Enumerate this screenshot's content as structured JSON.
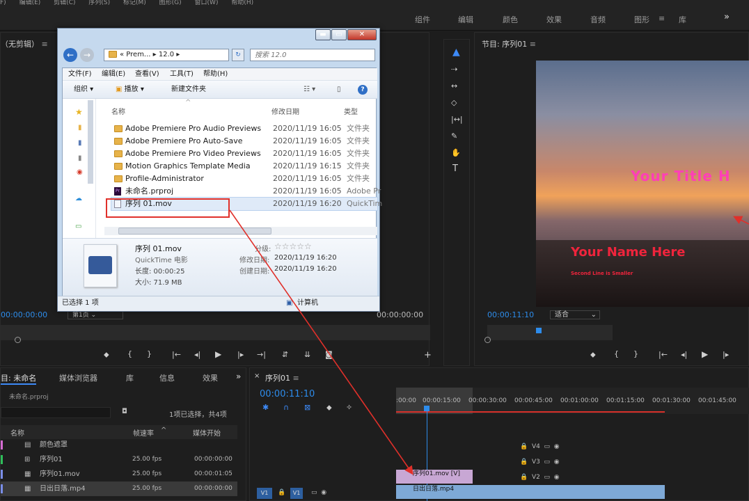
{
  "menubar": [
    "F)",
    "编辑(E)",
    "剪辑(C)",
    "序列(S)",
    "标记(M)",
    "图形(G)",
    "窗口(W)",
    "帮助(H)"
  ],
  "workspaces": {
    "items": [
      "组件",
      "编辑",
      "颜色",
      "效果",
      "音频",
      "图形",
      "库"
    ],
    "active": "图形",
    "overflow": "»"
  },
  "source_panel": {
    "title": "（无剪辑）",
    "timecode_left": "00:00:00:00",
    "timecode_right": "00:00:00:00",
    "page": "第1页"
  },
  "program": {
    "title": "节目: 序列01",
    "timecode": "00:00:11:10",
    "fit": "适合",
    "title_line1": "Your Title H",
    "name_line": "Your Name Here",
    "second_line": "Second Line is Smaller"
  },
  "project": {
    "tabs": [
      "目: 未命名",
      "媒体浏览器",
      "库",
      "信息",
      "效果"
    ],
    "project_file": "未命名.prproj",
    "selection": "1项已选择，共4项",
    "col_name": "名称",
    "col_fps": "帧速率",
    "col_start": "媒体开始",
    "rows": [
      {
        "name": "颜色遮罩",
        "fps": "",
        "start": ""
      },
      {
        "name": "序列01",
        "fps": "25.00 fps",
        "start": "00:00:00:00"
      },
      {
        "name": "序列01.mov",
        "fps": "25.00 fps",
        "start": "00:00:01:05"
      },
      {
        "name": "日出日落.mp4",
        "fps": "25.00 fps",
        "start": "00:00:00:00"
      }
    ]
  },
  "timeline": {
    "tab": "序列01",
    "timecode": "00:00:11:10",
    "ruler": [
      ":00:00",
      "00:00:15:00",
      "00:00:30:00",
      "00:00:45:00",
      "00:01:00:00",
      "00:01:15:00",
      "00:01:30:00",
      "00:01:45:00"
    ],
    "tracks": [
      "V4",
      "V3",
      "V2",
      "V1"
    ],
    "src_track": "V1",
    "clip_v2": "序列01.mov [V]",
    "clip_v1": "日出日落.mp4"
  },
  "dialog": {
    "breadcrumb": [
      "« Prem...",
      "12.0"
    ],
    "search_placeholder": "搜索 12.0",
    "menu": [
      "文件(F)",
      "编辑(E)",
      "查看(V)",
      "工具(T)",
      "帮助(H)"
    ],
    "toolbar": {
      "organize": "组织",
      "play": "播放",
      "newfolder": "新建文件夹"
    },
    "headers": {
      "name": "名称",
      "date": "修改日期",
      "type": "类型"
    },
    "files": [
      {
        "name": "Adobe Premiere Pro Audio Previews",
        "date": "2020/11/19 16:05",
        "type": "文件夹"
      },
      {
        "name": "Adobe Premiere Pro Auto-Save",
        "date": "2020/11/19 16:05",
        "type": "文件夹"
      },
      {
        "name": "Adobe Premiere Pro Video Previews",
        "date": "2020/11/19 16:05",
        "type": "文件夹"
      },
      {
        "name": "Motion Graphics Template Media",
        "date": "2020/11/19 16:15",
        "type": "文件夹"
      },
      {
        "name": "Profile-Administrator",
        "date": "2020/11/19 16:05",
        "type": "文件夹"
      },
      {
        "name": "未命名.prproj",
        "date": "2020/11/19 16:05",
        "type": "Adobe Pr"
      },
      {
        "name": "序列 01.mov",
        "date": "2020/11/19 16:20",
        "type": "QuickTim"
      }
    ],
    "details": {
      "name": "序列 01.mov",
      "kind": "QuickTime 电影",
      "length": "长度: 00:00:25",
      "size": "大小: 71.9 MB",
      "rating": "分级:",
      "modified_label": "修改日期:",
      "modified": "2020/11/19 16:20",
      "created_label": "创建日期:",
      "created": "2020/11/19 16:20",
      "stars": "☆☆☆☆☆"
    },
    "status": "已选择 1 项",
    "computer": "计算机"
  },
  "colors": {
    "accent": "#2d8ceb",
    "highlight_red": "#e0302a",
    "title_pink": "#ff3fb6",
    "clip_blue": "#7ea9d6"
  }
}
